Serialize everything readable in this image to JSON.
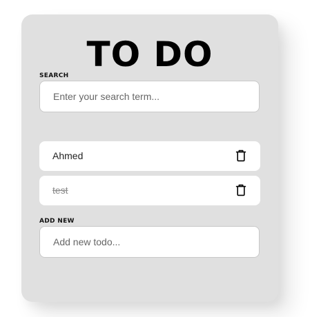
{
  "title": "TO DO",
  "search": {
    "label": "SEARCH",
    "placeholder": "Enter your search term..."
  },
  "todos": [
    {
      "text": "Ahmed",
      "completed": false,
      "delete_icon": "trash-icon"
    },
    {
      "text": "test",
      "completed": true,
      "delete_icon": "trash-icon"
    }
  ],
  "add_new": {
    "label": "ADD NEW",
    "placeholder": "Add new todo..."
  },
  "colors": {
    "card_background": "#e0e0e0",
    "item_background": "#ffffff",
    "completed_text": "#8a8a8a"
  }
}
